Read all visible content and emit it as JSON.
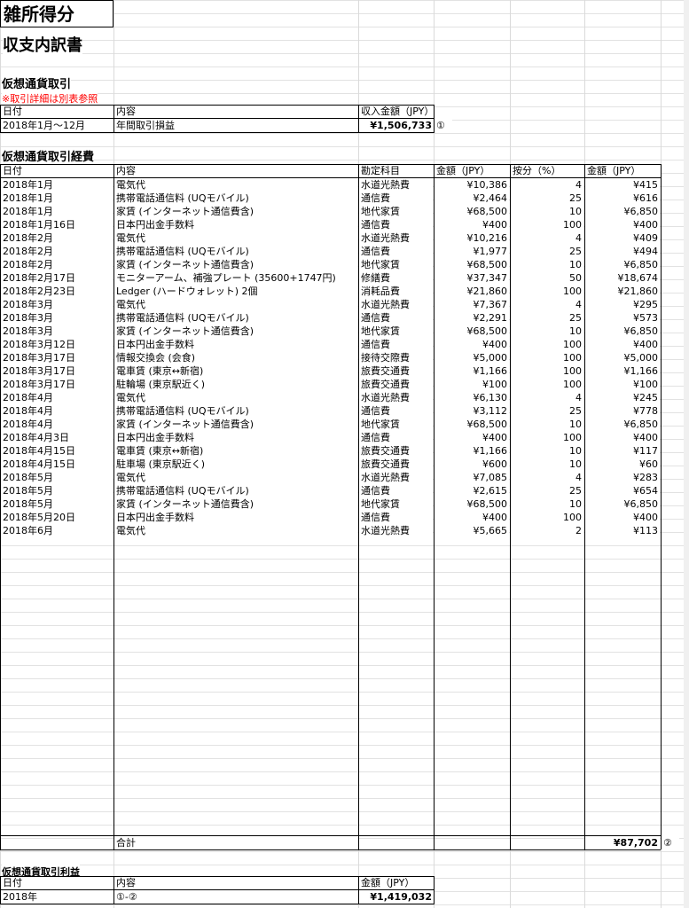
{
  "title": "雑所得分",
  "subtitle": "収支内訳書",
  "income_section": {
    "heading": "仮想通貨取引",
    "note": "※取引詳細は別表参照",
    "headers": [
      "日付",
      "内容",
      "収入金額（JPY）"
    ],
    "row": [
      "2018年1月～12月",
      "年間取引損益",
      "¥1,506,733"
    ],
    "marker": "①"
  },
  "expense_section": {
    "heading": "仮想通貨取引経費",
    "headers": [
      "日付",
      "内容",
      "勘定科目",
      "金額（JPY）",
      "按分（%）",
      "金額（JPY）"
    ],
    "rows": [
      [
        "2018年1月",
        "電気代",
        "水道光熱費",
        "¥10,386",
        "4",
        "¥415"
      ],
      [
        "2018年1月",
        "携帯電話通信料 (UQモバイル)",
        "通信費",
        "¥2,464",
        "25",
        "¥616"
      ],
      [
        "2018年1月",
        "家賃 (インターネット通信費含)",
        "地代家賃",
        "¥68,500",
        "10",
        "¥6,850"
      ],
      [
        "2018年1月16日",
        "日本円出金手数料",
        "通信費",
        "¥400",
        "100",
        "¥400"
      ],
      [
        "2018年2月",
        "電気代",
        "水道光熱費",
        "¥10,216",
        "4",
        "¥409"
      ],
      [
        "2018年2月",
        "携帯電話通信料 (UQモバイル)",
        "通信費",
        "¥1,977",
        "25",
        "¥494"
      ],
      [
        "2018年2月",
        "家賃 (インターネット通信費含)",
        "地代家賃",
        "¥68,500",
        "10",
        "¥6,850"
      ],
      [
        "2018年2月17日",
        "モニターアーム、補強プレート (35600+1747円)",
        "修繕費",
        "¥37,347",
        "50",
        "¥18,674"
      ],
      [
        "2018年2月23日",
        "Ledger (ハードウォレット) 2個",
        "消耗品費",
        "¥21,860",
        "100",
        "¥21,860"
      ],
      [
        "2018年3月",
        "電気代",
        "水道光熱費",
        "¥7,367",
        "4",
        "¥295"
      ],
      [
        "2018年3月",
        "携帯電話通信料 (UQモバイル)",
        "通信費",
        "¥2,291",
        "25",
        "¥573"
      ],
      [
        "2018年3月",
        "家賃 (インターネット通信費含)",
        "地代家賃",
        "¥68,500",
        "10",
        "¥6,850"
      ],
      [
        "2018年3月12日",
        "日本円出金手数料",
        "通信費",
        "¥400",
        "100",
        "¥400"
      ],
      [
        "2018年3月17日",
        "情報交換会 (会食)",
        "接待交際費",
        "¥5,000",
        "100",
        "¥5,000"
      ],
      [
        "2018年3月17日",
        "電車賃 (東京↔新宿)",
        "旅費交通費",
        "¥1,166",
        "100",
        "¥1,166"
      ],
      [
        "2018年3月17日",
        "駐輪場 (東京駅近く)",
        "旅費交通費",
        "¥100",
        "100",
        "¥100"
      ],
      [
        "2018年4月",
        "電気代",
        "水道光熱費",
        "¥6,130",
        "4",
        "¥245"
      ],
      [
        "2018年4月",
        "携帯電話通信料 (UQモバイル)",
        "通信費",
        "¥3,112",
        "25",
        "¥778"
      ],
      [
        "2018年4月",
        "家賃 (インターネット通信費含)",
        "地代家賃",
        "¥68,500",
        "10",
        "¥6,850"
      ],
      [
        "2018年4月3日",
        "日本円出金手数料",
        "通信費",
        "¥400",
        "100",
        "¥400"
      ],
      [
        "2018年4月15日",
        "電車賃 (東京↔新宿)",
        "旅費交通費",
        "¥1,166",
        "10",
        "¥117"
      ],
      [
        "2018年4月15日",
        "駐車場 (東京駅近く)",
        "旅費交通費",
        "¥600",
        "10",
        "¥60"
      ],
      [
        "2018年5月",
        "電気代",
        "水道光熱費",
        "¥7,085",
        "4",
        "¥283"
      ],
      [
        "2018年5月",
        "携帯電話通信料 (UQモバイル)",
        "通信費",
        "¥2,615",
        "25",
        "¥654"
      ],
      [
        "2018年5月",
        "家賃 (インターネット通信費含)",
        "地代家賃",
        "¥68,500",
        "10",
        "¥6,850"
      ],
      [
        "2018年5月20日",
        "日本円出金手数料",
        "通信費",
        "¥400",
        "100",
        "¥400"
      ],
      [
        "2018年6月",
        "電気代",
        "水道光熱費",
        "¥5,665",
        "2",
        "¥113"
      ]
    ],
    "total_label": "合計",
    "total_value": "¥87,702",
    "marker": "②"
  },
  "profit_section": {
    "heading": "仮想通貨取引利益",
    "headers": [
      "日付",
      "内容",
      "金額（JPY）"
    ],
    "row": [
      "2018年",
      "①-②",
      "¥1,419,032"
    ]
  }
}
